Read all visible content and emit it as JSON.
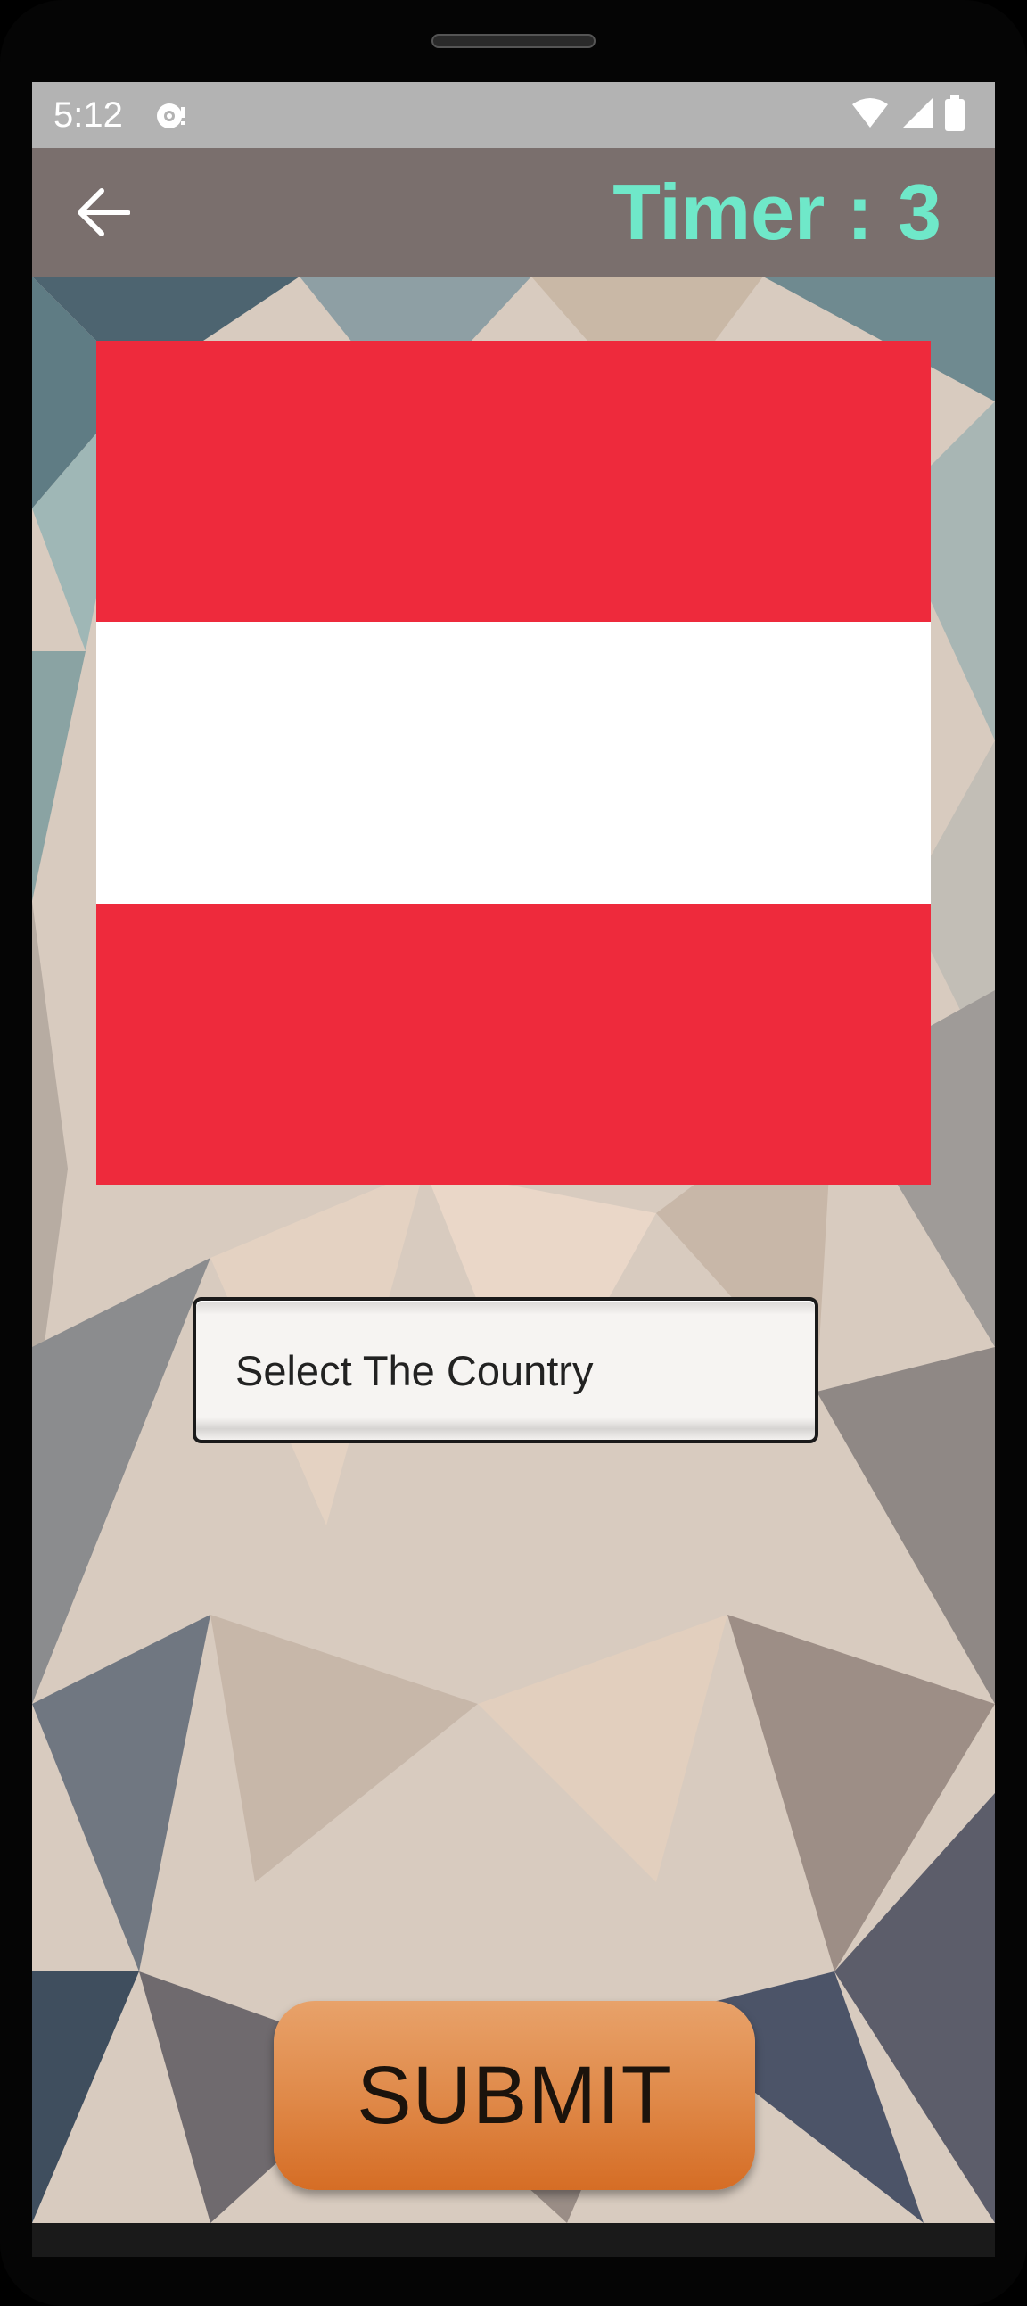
{
  "status_bar": {
    "time": "5:12"
  },
  "app_bar": {
    "timer_label": "Timer :",
    "timer_value": "3",
    "timer_color": "#6fe8c9",
    "background_color": "#7a6f6d"
  },
  "flag": {
    "stripes": [
      "#ee2a3c",
      "#ffffff",
      "#ee2a3c"
    ]
  },
  "country_select": {
    "selected_value": "Select The Country"
  },
  "submit": {
    "label": "SUBMIT"
  }
}
